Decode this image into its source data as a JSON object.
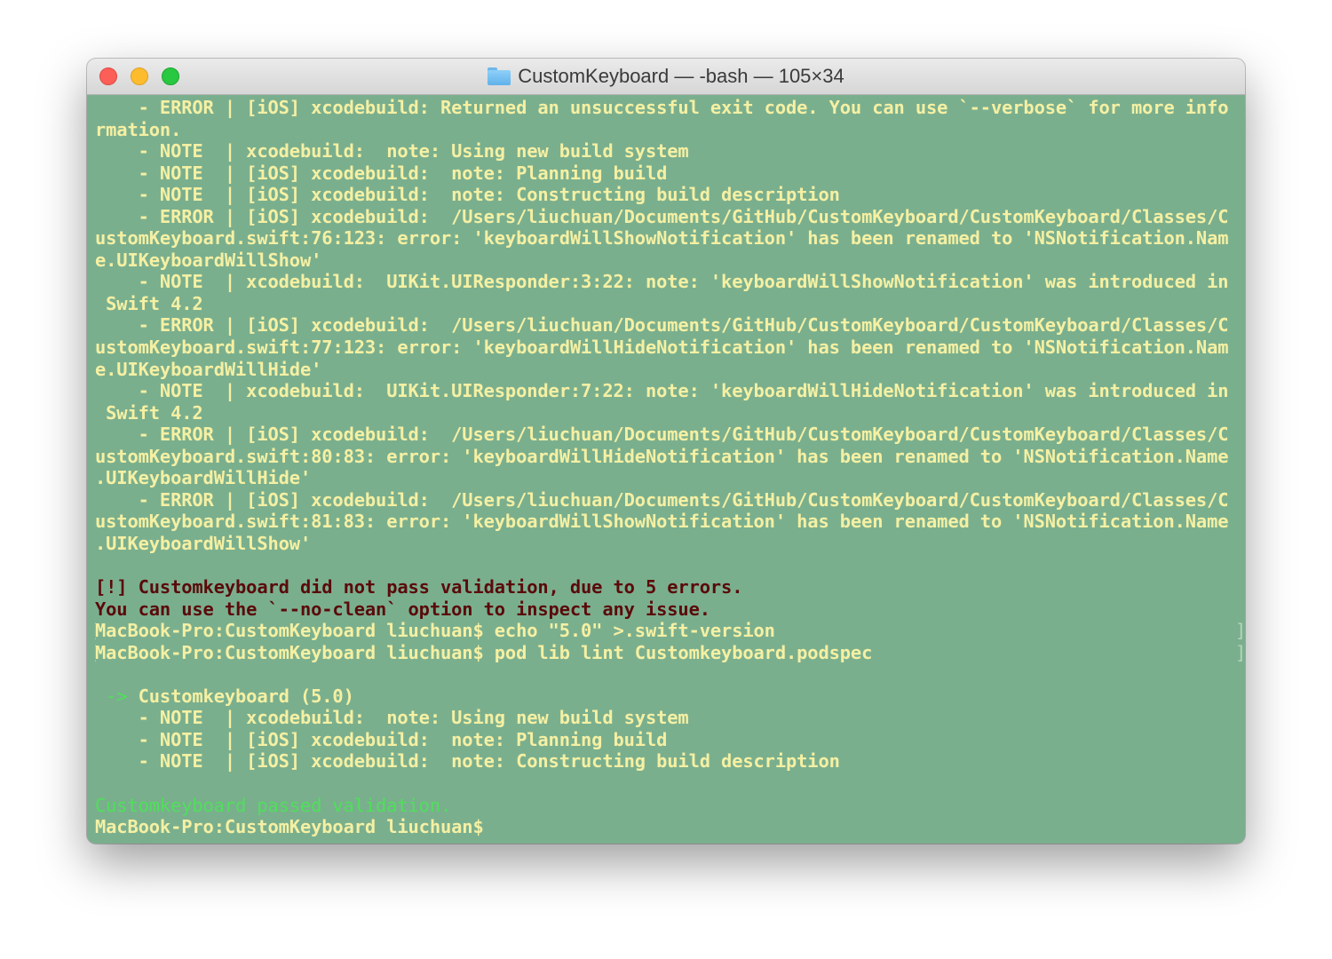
{
  "window": {
    "title": "CustomKeyboard — -bash — 105×34"
  },
  "terminal": {
    "lines": [
      "    - ERROR | [iOS] xcodebuild: Returned an unsuccessful exit code. You can use `--verbose` for more info",
      "rmation.",
      "    - NOTE  | xcodebuild:  note: Using new build system",
      "    - NOTE  | [iOS] xcodebuild:  note: Planning build",
      "    - NOTE  | [iOS] xcodebuild:  note: Constructing build description",
      "    - ERROR | [iOS] xcodebuild:  /Users/liuchuan/Documents/GitHub/CustomKeyboard/CustomKeyboard/Classes/C",
      "ustomKeyboard.swift:76:123: error: 'keyboardWillShowNotification' has been renamed to 'NSNotification.Nam",
      "e.UIKeyboardWillShow'",
      "    - NOTE  | xcodebuild:  UIKit.UIResponder:3:22: note: 'keyboardWillShowNotification' was introduced in",
      " Swift 4.2",
      "    - ERROR | [iOS] xcodebuild:  /Users/liuchuan/Documents/GitHub/CustomKeyboard/CustomKeyboard/Classes/C",
      "ustomKeyboard.swift:77:123: error: 'keyboardWillHideNotification' has been renamed to 'NSNotification.Nam",
      "e.UIKeyboardWillHide'",
      "    - NOTE  | xcodebuild:  UIKit.UIResponder:7:22: note: 'keyboardWillHideNotification' was introduced in",
      " Swift 4.2",
      "    - ERROR | [iOS] xcodebuild:  /Users/liuchuan/Documents/GitHub/CustomKeyboard/CustomKeyboard/Classes/C",
      "ustomKeyboard.swift:80:83: error: 'keyboardWillHideNotification' has been renamed to 'NSNotification.Name",
      ".UIKeyboardWillHide'",
      "    - ERROR | [iOS] xcodebuild:  /Users/liuchuan/Documents/GitHub/CustomKeyboard/CustomKeyboard/Classes/C",
      "ustomKeyboard.swift:81:83: error: 'keyboardWillShowNotification' has been renamed to 'NSNotification.Name",
      ".UIKeyboardWillShow'",
      "",
      "[!] Customkeyboard did not pass validation, due to 5 errors.",
      "You can use the `--no-clean` option to inspect any issue.",
      "MacBook-Pro:CustomKeyboard liuchuan$ echo \"5.0\" >.swift-version",
      "MacBook-Pro:CustomKeyboard liuchuan$ pod lib lint Customkeyboard.podspec",
      "",
      "Customkeyboard (5.0)",
      "    - NOTE  | xcodebuild:  note: Using new build system",
      "    - NOTE  | [iOS] xcodebuild:  note: Planning build",
      "    - NOTE  | [iOS] xcodebuild:  note: Constructing build description",
      "",
      "Customkeyboard passed validation.",
      "MacBook-Pro:CustomKeyboard liuchuan$ "
    ],
    "arrow_prefix": " -> ",
    "bracket_left": "[",
    "bracket_right": "]"
  },
  "colors": {
    "background": "#7aaf8e",
    "text": "#f5f0a3",
    "error_text": "#5a0a0a",
    "success_text": "#4fe05a"
  },
  "icons": {
    "title_icon": "folder-icon",
    "close": "close-icon",
    "minimize": "minimize-icon",
    "zoom": "zoom-icon"
  }
}
